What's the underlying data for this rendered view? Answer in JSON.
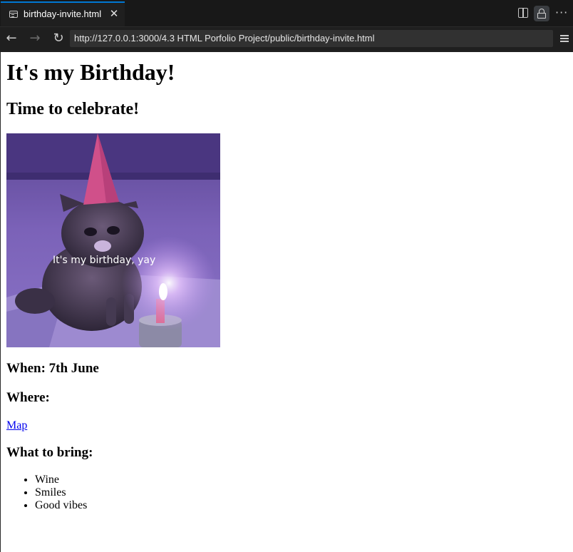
{
  "tab": {
    "title": "birthday-invite.html",
    "close_glyph": "✕"
  },
  "toolbar_icons": [
    "split-editor-icon",
    "lock-icon",
    "more-icon"
  ],
  "nav": {
    "back_glyph": "←",
    "forward_glyph": "→",
    "reload_glyph": "↻",
    "url": "http://127.0.0.1:3000/4.3 HTML Porfolio Project/public/birthday-invite.html"
  },
  "page": {
    "heading": "It's my Birthday!",
    "subheading": "Time to celebrate!",
    "image_caption": "It's my birthday, yay",
    "when": "When: 7th June",
    "where": "Where:",
    "map_link": "Map",
    "bring_heading": "What to bring:",
    "bring_items": [
      "Wine",
      "Smiles",
      "Good vibes"
    ]
  },
  "colors": {
    "accent": "#0078d4",
    "link": "#0000ee",
    "chrome_bg": "#1f1f1f",
    "image_purple": "#7a5bb8"
  }
}
